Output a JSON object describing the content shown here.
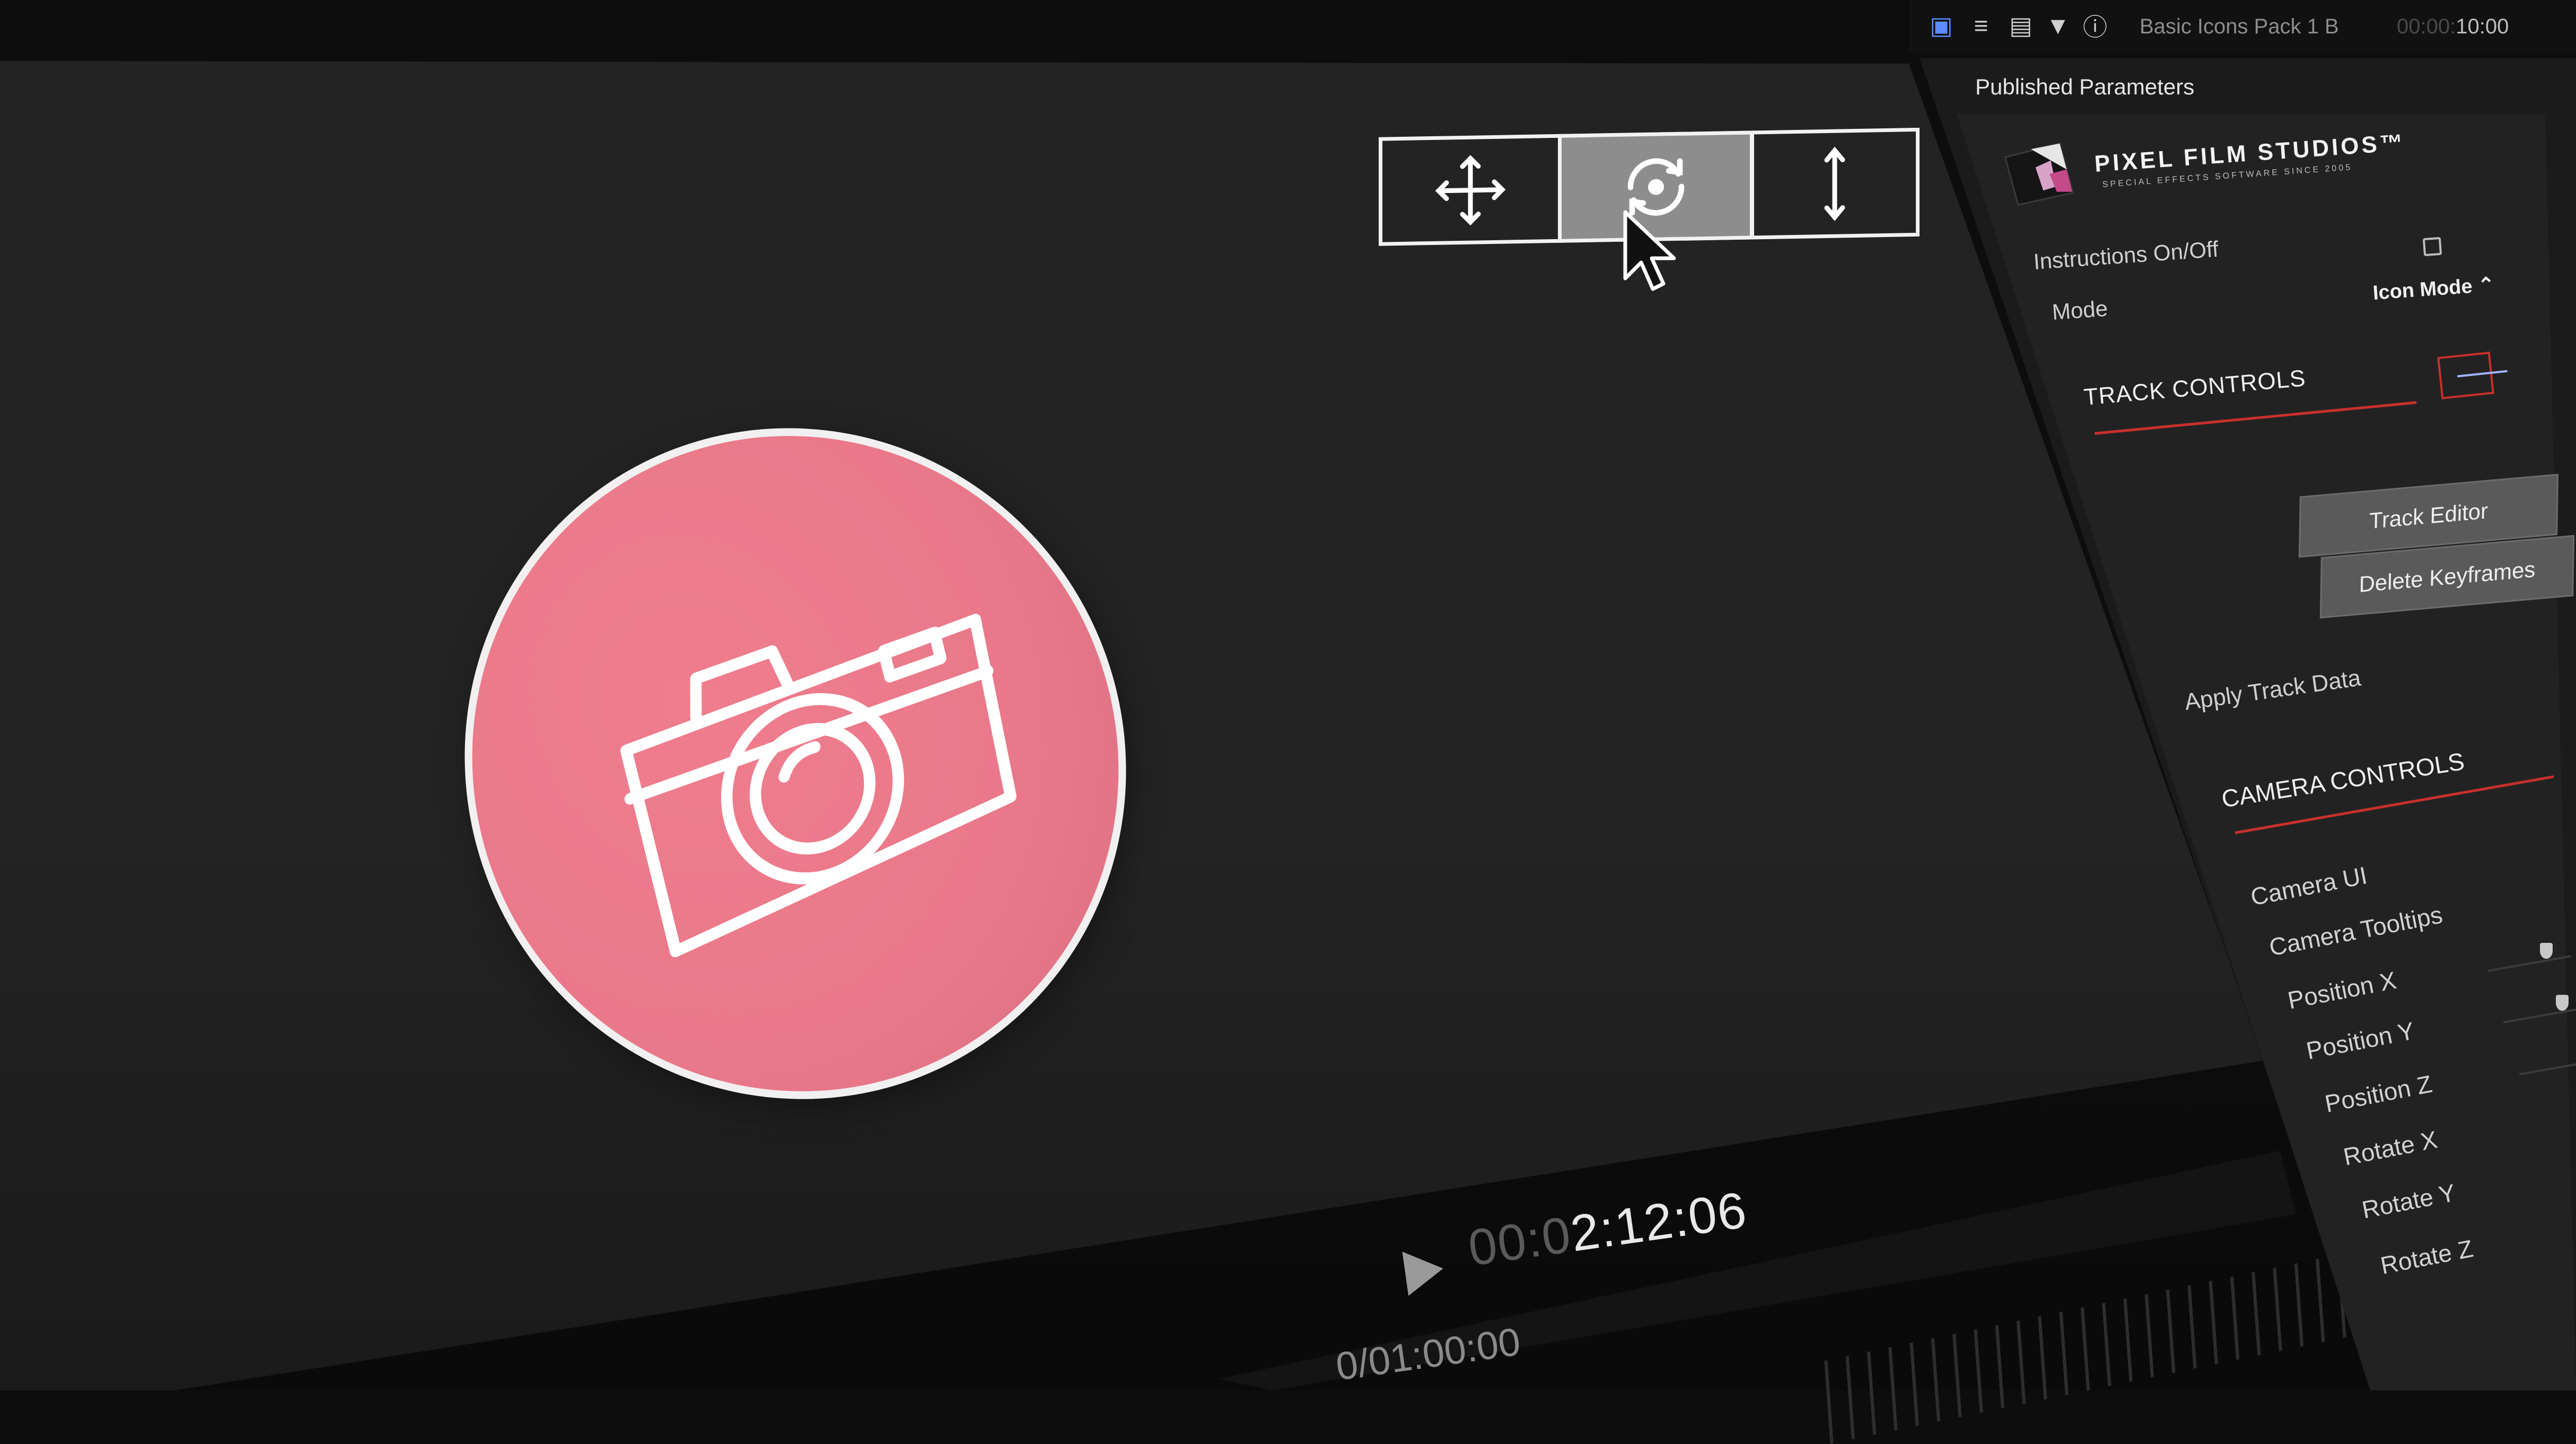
{
  "viewer": {
    "timecode_dim": "00:0",
    "timecode_main": "2:12:06",
    "duration": "0/01:00:00"
  },
  "onscreen_controls": {
    "tools": [
      "move-icon",
      "rotate-icon",
      "scale-vertical-icon"
    ],
    "active_tool": "rotate"
  },
  "icon_disc": {
    "icon": "camera-icon",
    "fill_color": "#e9788a",
    "border_color": "#f1efef"
  },
  "inspector": {
    "tabs": [
      "info-icon",
      "text-icon",
      "film-icon",
      "filter-icon",
      "about-icon"
    ],
    "clip_name": "Basic Icons Pack 1 B",
    "clip_time_dim": "00:00:",
    "clip_time": "10:00",
    "section_title": "Published Parameters",
    "logo": {
      "name": "PIXEL FILM STUDIOS™",
      "tagline": "SPECIAL EFFECTS SOFTWARE SINCE 2005"
    },
    "instructions_label": "Instructions On/Off",
    "mode_label": "Mode",
    "mode_value": "Icon Mode ⌃",
    "track_controls_heading": "TRACK CONTROLS",
    "track_editor_button": "Track Editor",
    "delete_keyframes_button": "Delete Keyframes",
    "apply_track_data_label": "Apply Track Data",
    "camera_controls_heading": "CAMERA CONTROLS",
    "camera_params": [
      "Camera UI",
      "Camera Tooltips",
      "Position X",
      "Position Y",
      "Position Z",
      "Rotate X",
      "Rotate Y",
      "Rotate Z"
    ],
    "accent_color": "#c9302c"
  }
}
